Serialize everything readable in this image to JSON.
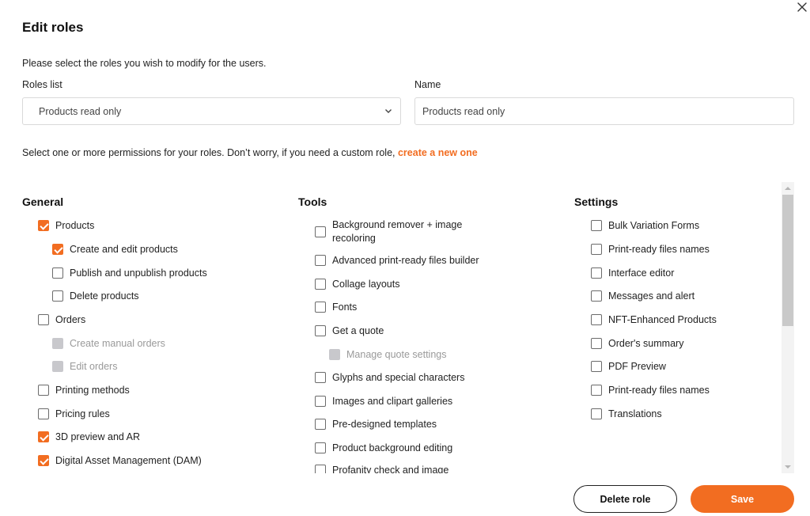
{
  "colors": {
    "accent": "#f26d21",
    "disabled": "#c8c8cc"
  },
  "dialog": {
    "title": "Edit roles",
    "close_icon": "close-icon",
    "intro": "Please select the roles you wish to modify for the users."
  },
  "form": {
    "roles_list_label": "Roles list",
    "roles_list_value": "Products read only",
    "name_label": "Name",
    "name_value": "Products read only"
  },
  "permissions": {
    "text": "Select one or more permissions for your roles. Don’t worry, if you need a custom role,",
    "link": "create a new one"
  },
  "columns": {
    "general": {
      "title": "General",
      "items": [
        {
          "label": "Products",
          "state": "checked"
        },
        {
          "label": "Create and edit products",
          "state": "checked"
        },
        {
          "label": "Publish and unpublish products",
          "state": "unchecked"
        },
        {
          "label": "Delete products",
          "state": "unchecked"
        },
        {
          "label": "Orders",
          "state": "unchecked"
        },
        {
          "label": "Create manual orders",
          "state": "disabled"
        },
        {
          "label": "Edit orders",
          "state": "disabled"
        },
        {
          "label": "Printing methods",
          "state": "unchecked"
        },
        {
          "label": "Pricing rules",
          "state": "unchecked"
        },
        {
          "label": "3D preview and AR",
          "state": "checked"
        },
        {
          "label": "Digital Asset Management (DAM)",
          "state": "checked"
        }
      ]
    },
    "tools": {
      "title": "Tools",
      "items": [
        {
          "label": "Background remover + image recoloring",
          "state": "unchecked"
        },
        {
          "label": "Advanced print-ready files builder",
          "state": "unchecked"
        },
        {
          "label": "Collage layouts",
          "state": "unchecked"
        },
        {
          "label": "Fonts",
          "state": "unchecked"
        },
        {
          "label": "Get a quote",
          "state": "unchecked"
        },
        {
          "label": "Manage quote settings",
          "state": "disabled"
        },
        {
          "label": "Glyphs and special characters",
          "state": "unchecked"
        },
        {
          "label": "Images and clipart galleries",
          "state": "unchecked"
        },
        {
          "label": "Pre-designed templates",
          "state": "unchecked"
        },
        {
          "label": "Product background editing",
          "state": "unchecked"
        },
        {
          "label": "Profanity check and image",
          "state": "unchecked"
        }
      ]
    },
    "settings": {
      "title": "Settings",
      "items": [
        {
          "label": "Bulk Variation Forms",
          "state": "unchecked"
        },
        {
          "label": "Print-ready files names",
          "state": "unchecked"
        },
        {
          "label": "Interface editor",
          "state": "unchecked"
        },
        {
          "label": "Messages and alert",
          "state": "unchecked"
        },
        {
          "label": "NFT-Enhanced Products",
          "state": "unchecked"
        },
        {
          "label": "Order's summary",
          "state": "unchecked"
        },
        {
          "label": "PDF Preview",
          "state": "unchecked"
        },
        {
          "label": "Print-ready files names",
          "state": "unchecked"
        },
        {
          "label": "Translations",
          "state": "unchecked"
        }
      ]
    }
  },
  "footer": {
    "delete_label": "Delete role",
    "save_label": "Save"
  }
}
